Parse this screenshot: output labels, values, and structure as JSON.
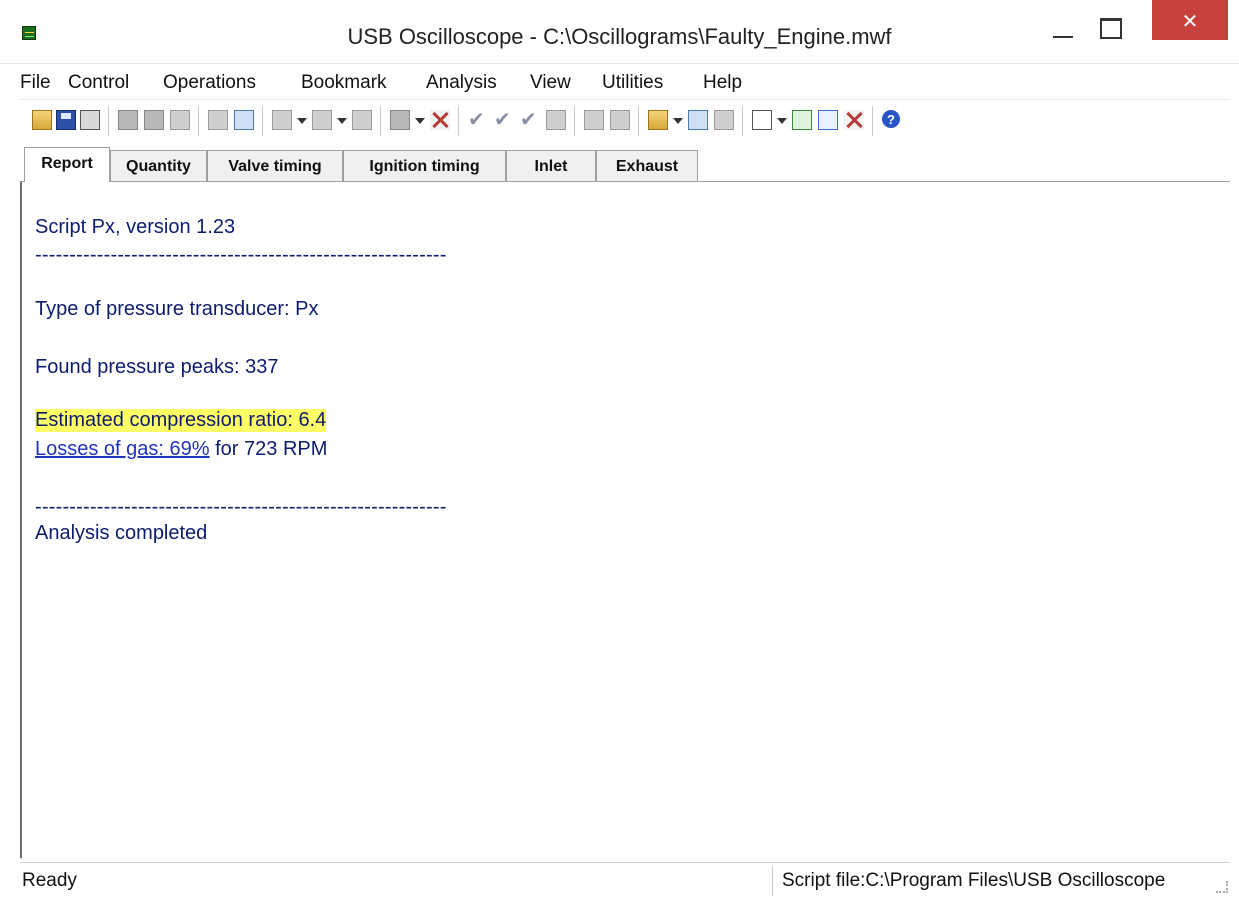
{
  "window": {
    "title": "USB Oscilloscope - C:\\Oscillograms\\Faulty_Engine.mwf",
    "close_glyph": "✕"
  },
  "menu": {
    "items": [
      {
        "label": "File"
      },
      {
        "label": "Control"
      },
      {
        "label": "Operations"
      },
      {
        "label": "Bookmark"
      },
      {
        "label": "Analysis"
      },
      {
        "label": "View"
      },
      {
        "label": "Utilities"
      },
      {
        "label": "Help"
      }
    ]
  },
  "toolbar": {
    "icons": [
      "open-icon",
      "save-icon",
      "print-icon",
      "copy-icon",
      "paste-icon",
      "marker-icon",
      "cursor-icon",
      "ruler-icon",
      "zoom-signal-icon",
      "zoom-signal-2-icon",
      "undo-icon",
      "filter-icon",
      "delete-icon",
      "check-icon",
      "check-down-icon",
      "check-down-2-icon",
      "page-icon",
      "chart-icon",
      "select-icon",
      "script-open-icon",
      "script-run-icon",
      "script-stop-icon",
      "script-window-icon",
      "graph-view-icon",
      "report-view-icon",
      "close-view-icon",
      "help-icon"
    ],
    "help_glyph": "?",
    "check_glyph": "✔"
  },
  "tabs": [
    {
      "label": "Report",
      "active": true
    },
    {
      "label": "Quantity",
      "active": false
    },
    {
      "label": "Valve timing",
      "active": false
    },
    {
      "label": "Ignition timing",
      "active": false
    },
    {
      "label": "Inlet",
      "active": false
    },
    {
      "label": "Exhaust",
      "active": false
    }
  ],
  "report": {
    "script_line": "Script Px, version 1.23",
    "separator": "------------------------------------------------------------",
    "transducer_line": "Type of pressure transducer: Px",
    "peaks_line": "Found pressure peaks: 337",
    "compression_line": "Estimated compression ratio: 6.4",
    "gas_loss_link": "Losses of gas: 69%",
    "gas_loss_suffix": " for 723 RPM",
    "completed_line": "Analysis completed",
    "highlight_color": "#ffff66"
  },
  "status": {
    "left": "Ready",
    "right": "Script file:C:\\Program Files\\USB Oscilloscope"
  }
}
